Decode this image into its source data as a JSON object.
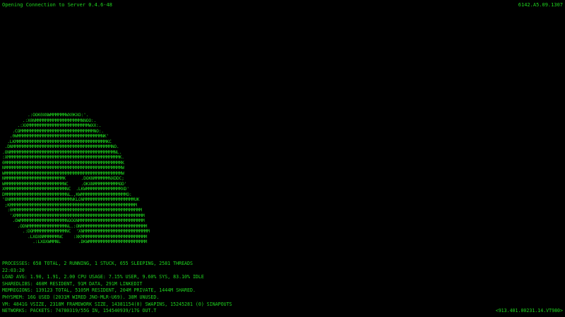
{
  "header": {
    "status_text": "Opening Connection to Server 0.4.6-48",
    "session_id": "6142.A5.09.1307"
  },
  "art": {
    "lines": [
      "          .:OOK0XNWMMMMMMWX0KXO:'.",
      "        .:X0NMMMMMMMMMMMMMMMMMMNNOO:.",
      "      .:XXMMMMMMMMMMMMMMMMMMMMMMMMWXX:.",
      "    .COMMMMMMMMMMMMMMMMMMMMMMMMMMMMMNO:.",
      "   .0WMMMMMMMMMMMMMMMMMMMMMMMMMMMMMMMMMNK'",
      "  .LKMMMMMMMMMMMMMMMMMMMMMMMMMMMMMMMMMMMMKC",
      " .DNMMMMMMMMMMMMMMMMMMMMMMMMMMMMMMMMMMMMMMMNO.",
      ".ONMMMMMMMMMMMMMMMMMMMMMMMMMMMMMMMMMMMMMMMMMNL.",
      ":XMMMMMMMMMMMMMMMMMMMMMMMMMMMMMMMMMMMMMMMMMMMMK.",
      "0MMMMMMMMMMMMMMMMMMMMMMMMMMMMMMMMMMMMMMMMMMMMMMK",
      "NMMMMMMMMMMMMMMMMMMMMMMMMMMMMMMMMMMMMMMMMMMMMMMW",
      "WMMMMMMMMMMMMMMMMMMMMMMMMMMMMMMMMMMMMMMMMMMMMMMW",
      "NMMMMMMMMMMMMMMMMMMMMMMMK      .DOKNMMMMMMNXDDC;",
      "WMMMMMMMMMMMMMMMMMMMMMMMNC     .OKXNMMMMMMMMMMOD'",
      "XMMMMMMMMMMMMMMMMMMMMMMMMNC  .LKWMMMMMMMMMMMMMMXD'",
      "DMMMMMMMMMMMMMMMMMMMMMMMMNL.,KWMMMMMMMMMMMMMMMMMMO:",
      "'ONMMMMMMMMMMMMMMMMMMMMMMMMNKLONMMMMMMMMMMMMMMMMMMMMUK",
      " ;KMMMMMMMMMMMMMMMMMMMMMMMMMMMMMMMMMMMMMMMMMMMMMMMMMM",
      "  :0MMMMMMMMMMMMMMMMMMMMMMMMMMMMMMMMMMMMMMMMMMMMMMMMMMM",
      "   'XMMMMMMMMMMMMMMMMMMMMMMMMMMMMMMMMMMMMMMMMMMMMMMMMMMM",
      "    .OWMMMMMMMMMMMMMMMMMMNOOONMMMMMMMMMMMMMMMMMMMMMMMMMM",
      "      .ODNMMMMMMMMMMMMMMMNL.:ONMMMMMMMMMMMMMMMMMMMMMMMMMM",
      "        .:DOMMMMMMMMMMMMMNC  'XNMMMMMMMMMMMMMMMMMMMMMMMMMM",
      "          .LXOXNMMMMMMNC    :XKMMMMMMMMMMMMMMMMMMMMMMMMMM",
      "            .:LXOXWMMNL       .DKWMMMMMMMMMMMMMMMMMMMMMMM"
    ]
  },
  "stats": {
    "processes": "PROCESSES: 658 TOTAL, 2 RUNNING, 1 STUCK, 655 SLEEPING, 2581 THREADS",
    "clock": "22:03:20",
    "load": "LOAD AVG: 1.90, 1.91, 2.00 CPU USAGE: 7.15% USER, 9.60% SYS, 83.10% IDLE",
    "sharedlibs": "SHAREDLIBS: 460M RESIDENT, 91M DATA, 291M LINKEDIT",
    "memregions": "MEMREGIONS: 139123 TOTAL, 5105M RESIDENT, 204M PRIVATE, 1444M SHARED.",
    "physmem": "PHYSMEM: 16G USED (2031M WIRED JNO-MLR-U69). 38M UNUSED.",
    "vm": "VM: 4841G VSIZE, 2318M FRAMEWORK SIZE, 14381154(0) SWAPINS, 15245281 (0) SINAPOUTS",
    "networks": "NETWORKS: PACKETS: 74780319/55G IN, 154540939/17G OUT.T"
  },
  "footer": {
    "address": "<913.401.00231.14.VT980>"
  },
  "colors": {
    "background": "#000000",
    "terminal_green": "#1fd61f"
  }
}
